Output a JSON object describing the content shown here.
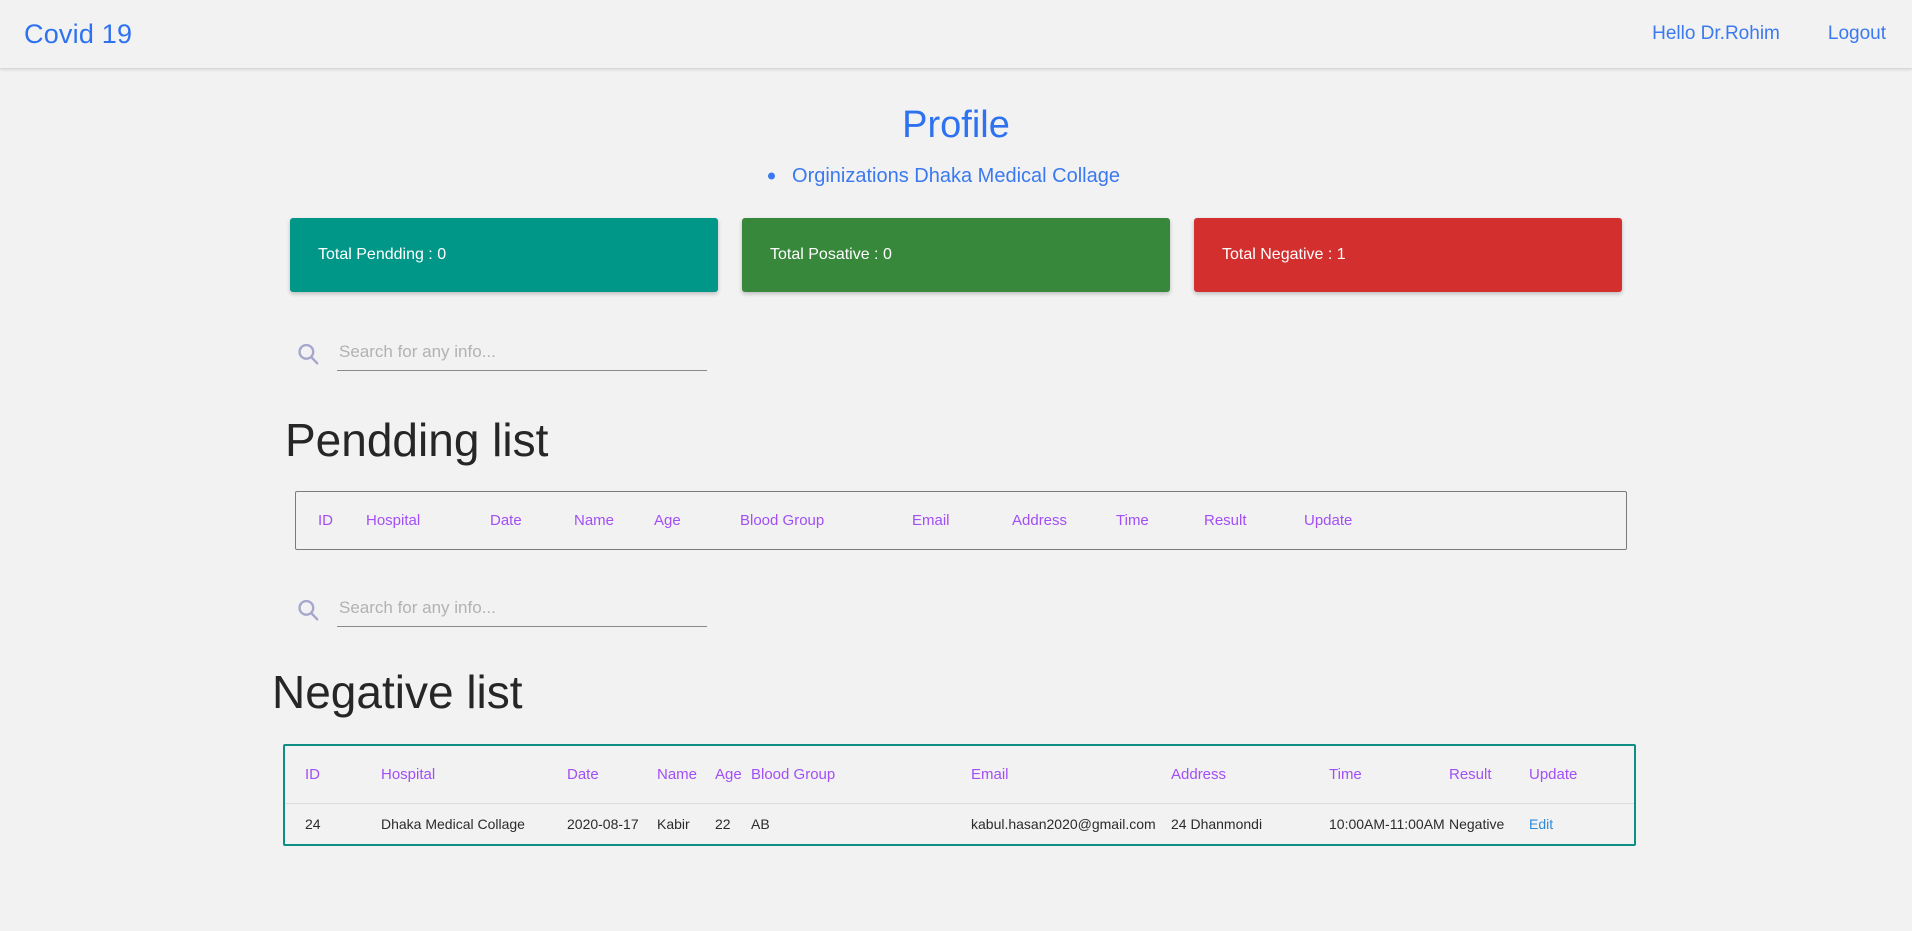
{
  "navbar": {
    "brand": "Covid 19",
    "greeting": "Hello Dr.Rohim",
    "logout": "Logout"
  },
  "page": {
    "title": "Profile",
    "organization": "Orginizations Dhaka Medical Collage"
  },
  "cards": [
    {
      "label": "Total Pendding : 0",
      "color": "#009688"
    },
    {
      "label": "Total Posative : 0",
      "color": "#37883a"
    },
    {
      "label": "Total Negative : 1",
      "color": "#d32f2f"
    }
  ],
  "search": {
    "placeholder": "Search for any info...",
    "value": "",
    "icon": "search-icon"
  },
  "pendding": {
    "heading": "Pendding list",
    "columns": [
      "ID",
      "Hospital",
      "Date",
      "Name",
      "Age",
      "Blood Group",
      "Email",
      "Address",
      "Time",
      "Result",
      "Update"
    ],
    "rows": []
  },
  "negative": {
    "heading": "Negative list",
    "columns": [
      "ID",
      "Hospital",
      "Date",
      "Name",
      "Age",
      "Blood Group",
      "Email",
      "Address",
      "Time",
      "Result",
      "Update"
    ],
    "rows": [
      {
        "id": "24",
        "hospital": "Dhaka Medical Collage",
        "date": "2020-08-17",
        "name": "Kabir",
        "age": "22",
        "blood_group": "AB",
        "email": "kabul.hasan2020@gmail.com",
        "address": "24 Dhanmondi",
        "time": "10:00AM-11:00AM",
        "result": "Negative",
        "update": "Edit"
      }
    ]
  },
  "colors": {
    "accent_blue": "#2f72f0",
    "header_purple": "#a24ff5",
    "teal_border": "#0f8e86",
    "background": "#f2f2f2"
  }
}
